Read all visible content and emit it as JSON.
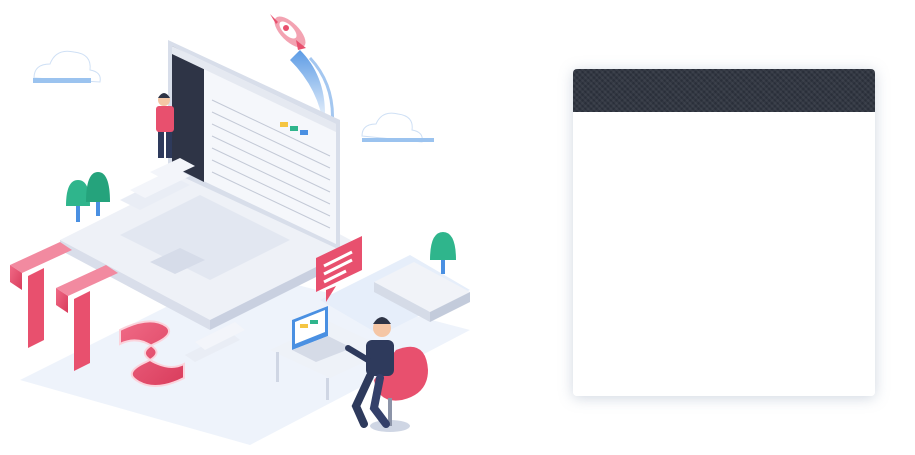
{
  "brand": {
    "logo_text": "TTS"
  },
  "login_panel": {
    "title": "",
    "header_color": "#2a2f3a",
    "body_color": "#ffffff"
  },
  "illustration": {
    "accent_pink": "#e8506e",
    "accent_blue": "#4a90e2",
    "tree_green": "#2fb58c",
    "laptop_screen": "#f5f7fb"
  }
}
